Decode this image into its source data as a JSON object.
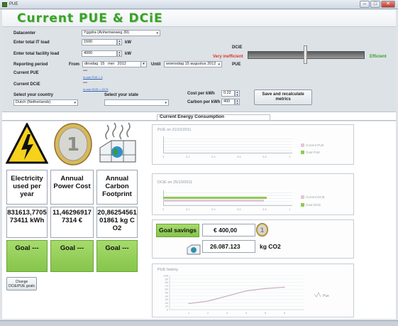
{
  "window": {
    "title": "PUE",
    "center_text": "",
    "minimize": "–",
    "maximize": "□",
    "close": "✕"
  },
  "app": {
    "title": "Current PUE & DCiE"
  },
  "form": {
    "datacenter_label": "Datacenter",
    "datacenter_value": "Yggdra (Anhemseweg 39)",
    "it_load_label": "Enter total IT load",
    "it_load_value": "1500",
    "it_load_unit": "kW",
    "facility_load_label": "Enter total facility load",
    "facility_load_value": "4000",
    "facility_load_unit": "kW",
    "reporting_label": "Reporting period",
    "from_label": "From",
    "from_weekday": "dinsdag",
    "from_day": "15",
    "from_month": "mei",
    "from_year": "2012",
    "until_label": "Until",
    "until_value": "woensdag 15 augustus 2012",
    "current_pue_label": "Current PUE",
    "current_pue_value": "---",
    "current_pue_link": "re-use PUE = 3",
    "current_dcie_label": "Current DCiE",
    "current_dcie_value": "---",
    "current_dcie_link": "re-use DCiE = 33 %",
    "country_label": "Select your country",
    "country_value": "Dutch (Netherlands)",
    "state_label": "Select your state",
    "state_value": "",
    "cost_label": "Cost per kWh",
    "cost_value": "0.22",
    "carbon_label": "Carbon per kWh",
    "carbon_value": "400",
    "save_button": "Save and recalculate metrics",
    "dcie_label": "DCiE",
    "pue_label": "PUE",
    "very_inefficient": "Very inefficient",
    "efficient": "Efficient"
  },
  "section": {
    "title": "Current Energy Consumption"
  },
  "tiles": {
    "labels": [
      "Electricity used per year",
      "Annual Power Cost",
      "Annual Carbon Footprint"
    ],
    "values": [
      "831613,770573411 kWh",
      "11,462969177314 €",
      "20,8625456101861 kg CO2"
    ],
    "goals": [
      "Goal ---",
      "Goal ---",
      "Goal ---"
    ]
  },
  "change_goals_button": "Change DCiE/PUE goals",
  "pue_panel": {
    "title": "PUE on 21/10/2011",
    "ticks": [
      "0",
      "0.2",
      "0.4",
      "0.6",
      "0.8",
      "1"
    ],
    "legend": [
      "Current PUE",
      "Goal PUE"
    ],
    "current": 0,
    "goal": 0
  },
  "dcie_panel": {
    "title": "DCiE on 25/10/2011",
    "ticks": [
      "0",
      "0.2",
      "0.4",
      "0.6",
      "0.8",
      "1"
    ],
    "legend": [
      "Current DCiE",
      "Goal DCiE"
    ],
    "current": 0.78,
    "goal": 0.8
  },
  "savings": {
    "label": "Goal savings",
    "money": "€ 400,00",
    "co2_value": "26.087.123",
    "co2_unit": "kg CO2"
  },
  "history": {
    "title": "PUE history",
    "yticks": [
      "100",
      "90",
      "80",
      "70",
      "60",
      "50",
      "40",
      "30",
      "20",
      "10",
      "0"
    ],
    "xticks": [
      "1",
      "2",
      "3",
      "4",
      "5",
      "6"
    ],
    "legend": "Pue",
    "chart_data": {
      "type": "line",
      "x": [
        1,
        2,
        3,
        4,
        5,
        6
      ],
      "y": [
        18,
        25,
        40,
        55,
        62,
        66
      ]
    }
  },
  "colors": {
    "accent": "#3aa12a",
    "goal": "#8fcb52",
    "current": "#e4c6dd",
    "inefficient": "#d83a2a",
    "efficient": "#3aa12a"
  }
}
